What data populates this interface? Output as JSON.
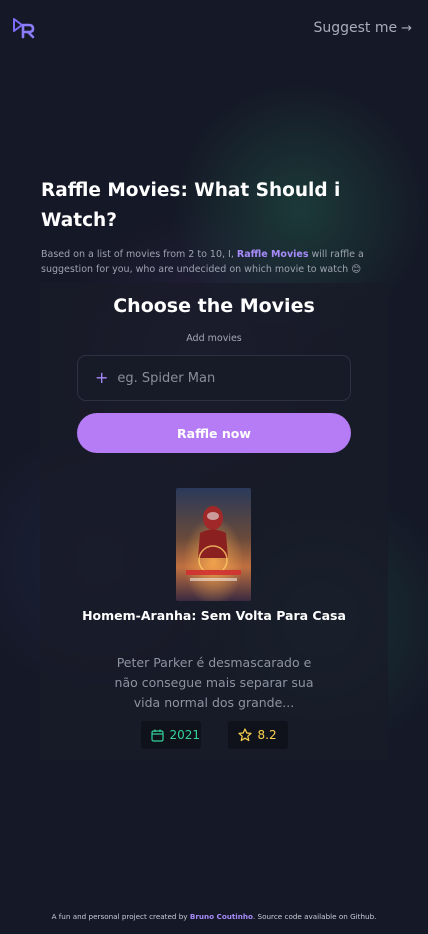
{
  "header": {
    "logo": "DR",
    "suggest_label": "Suggest me",
    "suggest_icon": "arrow-right-icon"
  },
  "hero": {
    "title": "Raffle Movies: What Should i Watch?",
    "desc_before": "Based on a list of movies from 2 to 10, I, ",
    "desc_brand": "Raffle Movies",
    "desc_after": " will raffle a suggestion for you, who are undecided on which movie to watch 😊"
  },
  "card": {
    "title": "Choose the Movies",
    "add_label": "Add movies",
    "input_placeholder": "eg. Spider Man",
    "input_value": "",
    "button_label": "Raffle now"
  },
  "movie": {
    "title": "Homem-Aranha: Sem Volta Para Casa",
    "description": "Peter Parker é desmascarado e não consegue mais separar sua vida normal dos grande...",
    "year": "2021",
    "rating": "8.2"
  },
  "footer": {
    "before": "A fun and personal project created by ",
    "author": "Bruno Coutinho",
    "after": ". Source code available on Github."
  },
  "colors": {
    "accent": "#b57cf5",
    "brand_text": "#a78bfa",
    "year": "#34d399",
    "rating": "#fcd34d"
  }
}
